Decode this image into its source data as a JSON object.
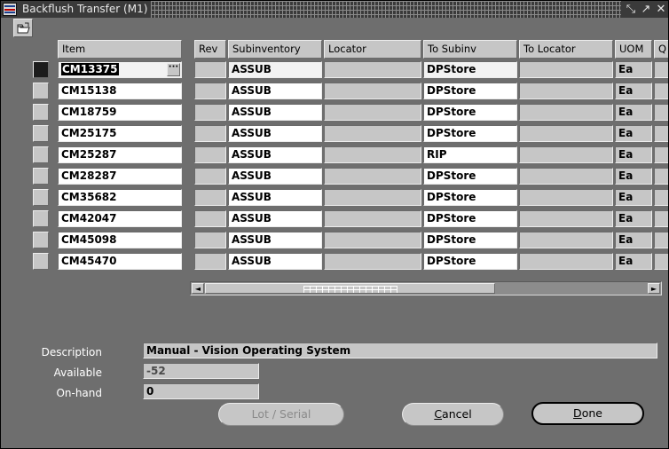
{
  "window": {
    "title": "Backflush Transfer (M1)",
    "app_icon": "oracle-forms-icon",
    "controls": [
      {
        "name": "minimize",
        "glyph": "⤡"
      },
      {
        "name": "maximize",
        "glyph": "↗"
      },
      {
        "name": "close",
        "glyph": "✕"
      }
    ],
    "canvas_color": "#6e6e6e",
    "titlebar_color": "#3a3a3a"
  },
  "toolbar": {
    "open_button_name": "open-folder-button",
    "open_button_tooltip": "Open"
  },
  "grid": {
    "columns": [
      {
        "key": "item",
        "label": "Item"
      },
      {
        "key": "rev",
        "label": "Rev"
      },
      {
        "key": "subinventory",
        "label": "Subinventory"
      },
      {
        "key": "locator",
        "label": "Locator"
      },
      {
        "key": "to_subinv",
        "label": "To Subinv"
      },
      {
        "key": "to_locator",
        "label": "To Locator"
      },
      {
        "key": "uom",
        "label": "UOM"
      },
      {
        "key": "quantity",
        "label": "Q"
      }
    ],
    "lov_button_label": "···",
    "rows": [
      {
        "item": "CM13375",
        "rev": "",
        "subinventory": "ASSUB",
        "locator": "",
        "to_subinv": "DPStore",
        "to_locator": "",
        "uom": "Ea",
        "quantity": "",
        "current": true,
        "selected_text": true
      },
      {
        "item": "CM15138",
        "rev": "",
        "subinventory": "ASSUB",
        "locator": "",
        "to_subinv": "DPStore",
        "to_locator": "",
        "uom": "Ea",
        "quantity": "",
        "current": false,
        "selected_text": false
      },
      {
        "item": "CM18759",
        "rev": "",
        "subinventory": "ASSUB",
        "locator": "",
        "to_subinv": "DPStore",
        "to_locator": "",
        "uom": "Ea",
        "quantity": "",
        "current": false,
        "selected_text": false
      },
      {
        "item": "CM25175",
        "rev": "",
        "subinventory": "ASSUB",
        "locator": "",
        "to_subinv": "DPStore",
        "to_locator": "",
        "uom": "Ea",
        "quantity": "",
        "current": false,
        "selected_text": false
      },
      {
        "item": "CM25287",
        "rev": "",
        "subinventory": "ASSUB",
        "locator": "",
        "to_subinv": "RIP",
        "to_locator": "",
        "uom": "Ea",
        "quantity": "",
        "current": false,
        "selected_text": false
      },
      {
        "item": "CM28287",
        "rev": "",
        "subinventory": "ASSUB",
        "locator": "",
        "to_subinv": "DPStore",
        "to_locator": "",
        "uom": "Ea",
        "quantity": "",
        "current": false,
        "selected_text": false
      },
      {
        "item": "CM35682",
        "rev": "",
        "subinventory": "ASSUB",
        "locator": "",
        "to_subinv": "DPStore",
        "to_locator": "",
        "uom": "Ea",
        "quantity": "",
        "current": false,
        "selected_text": false
      },
      {
        "item": "CM42047",
        "rev": "",
        "subinventory": "ASSUB",
        "locator": "",
        "to_subinv": "DPStore",
        "to_locator": "",
        "uom": "Ea",
        "quantity": "",
        "current": false,
        "selected_text": false
      },
      {
        "item": "CM45098",
        "rev": "",
        "subinventory": "ASSUB",
        "locator": "",
        "to_subinv": "DPStore",
        "to_locator": "",
        "uom": "Ea",
        "quantity": "",
        "current": false,
        "selected_text": false
      },
      {
        "item": "CM45470",
        "rev": "",
        "subinventory": "ASSUB",
        "locator": "",
        "to_subinv": "DPStore",
        "to_locator": "",
        "uom": "Ea",
        "quantity": "",
        "current": false,
        "selected_text": false
      }
    ]
  },
  "scrollbar": {
    "left_arrow": "◄",
    "right_arrow": "►",
    "thumb_position_pct": 0,
    "thumb_size_pct": 62
  },
  "details": {
    "description_label": "Description",
    "description_value": "Manual - Vision Operating System",
    "available_label": "Available",
    "available_value": "-52",
    "onhand_label": "On-hand",
    "onhand_value": "0"
  },
  "buttons": {
    "lot_serial": {
      "label": "Lot / Serial",
      "disabled": true
    },
    "cancel": {
      "label_pre": "",
      "label_accel": "C",
      "label_post": "ancel",
      "disabled": false
    },
    "done": {
      "label_pre": "",
      "label_accel": "D",
      "label_post": "one",
      "default": true
    }
  }
}
